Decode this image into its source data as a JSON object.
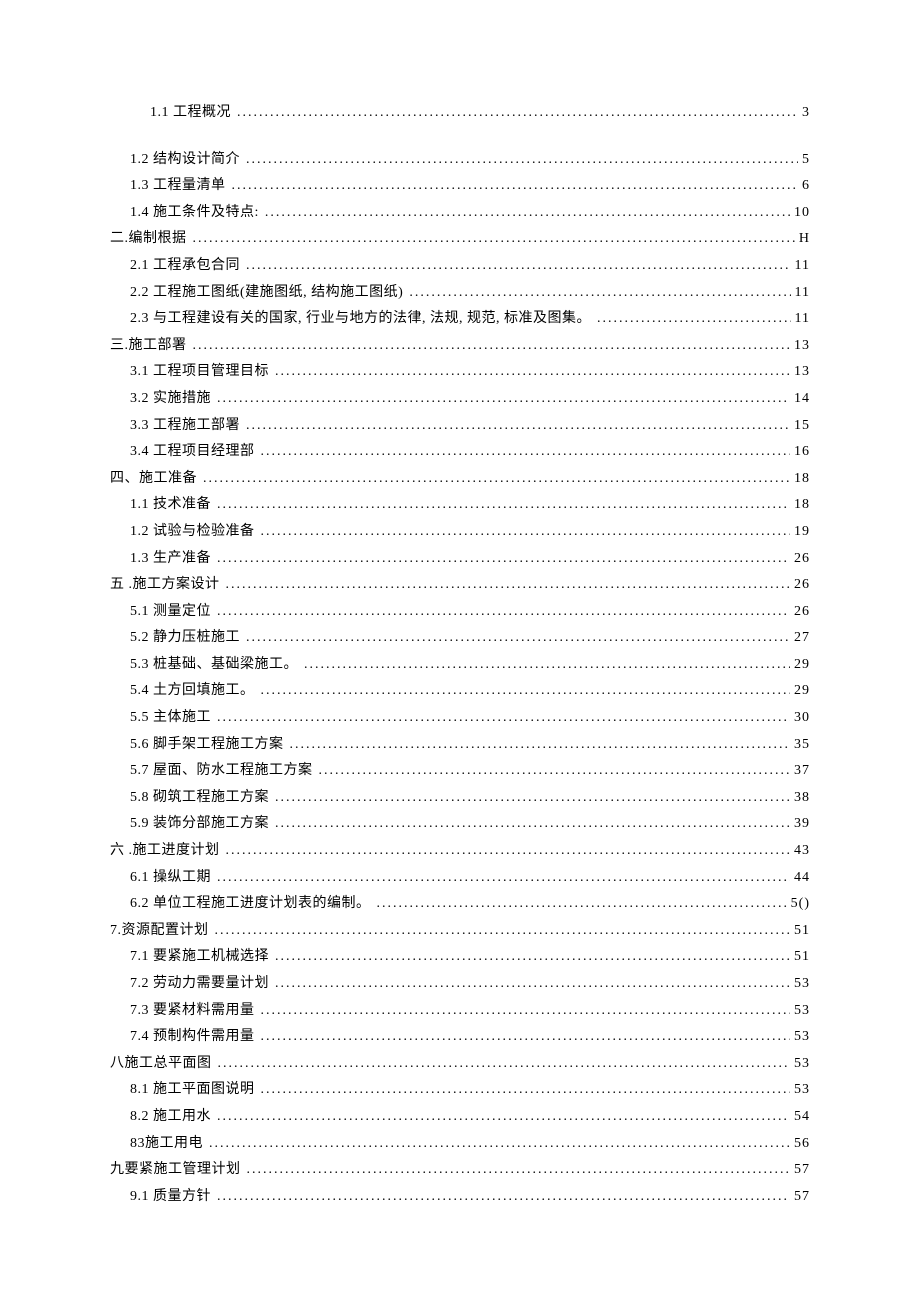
{
  "toc": [
    {
      "indent": "indent-first",
      "label": "1.1 工程概况",
      "page": "3"
    },
    {
      "indent": "indent-1",
      "label": "1.2 结构设计简介",
      "page": "5"
    },
    {
      "indent": "indent-1",
      "label": "1.3 工程量清单",
      "page": "6"
    },
    {
      "indent": "indent-1",
      "label": "1.4 施工条件及特点:",
      "page": "10"
    },
    {
      "indent": "indent-0",
      "label": "二.编制根据",
      "page": "H"
    },
    {
      "indent": "indent-1",
      "label": "2.1 工程承包合同",
      "page": "11"
    },
    {
      "indent": "indent-1",
      "label": "2.2 工程施工图纸(建施图纸, 结构施工图纸)",
      "page": "11"
    },
    {
      "indent": "indent-1",
      "label": "2.3 与工程建设有关的国家, 行业与地方的法律, 法规, 规范, 标准及图集。",
      "page": "11"
    },
    {
      "indent": "indent-0",
      "label": "三.施工部署",
      "page": "13"
    },
    {
      "indent": "indent-1",
      "label": "3.1 工程项目管理目标",
      "page": "13"
    },
    {
      "indent": "indent-1",
      "label": "3.2 实施措施",
      "page": "14"
    },
    {
      "indent": "indent-1",
      "label": "3.3 工程施工部署",
      "page": "15"
    },
    {
      "indent": "indent-1",
      "label": "3.4 工程项目经理部",
      "page": "16"
    },
    {
      "indent": "indent-0",
      "label": "四、施工准备",
      "page": "18"
    },
    {
      "indent": "indent-1",
      "label": "1.1 技术准备",
      "page": "18"
    },
    {
      "indent": "indent-1",
      "label": "1.2 试验与检验准备",
      "page": "19"
    },
    {
      "indent": "indent-1",
      "label": "1.3 生产准备",
      "page": "26"
    },
    {
      "indent": "indent-0",
      "label": "五 .施工方案设计",
      "page": "26"
    },
    {
      "indent": "indent-1",
      "label": "5.1 测量定位",
      "page": "26"
    },
    {
      "indent": "indent-1",
      "label": "5.2 静力压桩施工",
      "page": "27"
    },
    {
      "indent": "indent-1",
      "label": "5.3 桩基础、基础梁施工。",
      "page": "29"
    },
    {
      "indent": "indent-1",
      "label": "5.4 土方回填施工。",
      "page": "29"
    },
    {
      "indent": "indent-1",
      "label": "5.5 主体施工",
      "page": "30"
    },
    {
      "indent": "indent-1",
      "label": "5.6 脚手架工程施工方案",
      "page": "35"
    },
    {
      "indent": "indent-1",
      "label": "5.7 屋面、防水工程施工方案",
      "page": "37"
    },
    {
      "indent": "indent-1",
      "label": "5.8 砌筑工程施工方案",
      "page": "38"
    },
    {
      "indent": "indent-1",
      "label": "5.9 装饰分部施工方案",
      "page": "39"
    },
    {
      "indent": "indent-0",
      "label": "六 .施工进度计划",
      "page": "43"
    },
    {
      "indent": "indent-1",
      "label": "6.1 操纵工期",
      "page": "44"
    },
    {
      "indent": "indent-1",
      "label": "6.2 单位工程施工进度计划表的编制。",
      "page": "5()"
    },
    {
      "indent": "indent-0",
      "label": "7.资源配置计划",
      "page": "51"
    },
    {
      "indent": "indent-1",
      "label": "7.1 要紧施工机械选择",
      "page": "51"
    },
    {
      "indent": "indent-1",
      "label": "7.2 劳动力需要量计划",
      "page": "53"
    },
    {
      "indent": "indent-1",
      "label": "7.3 要紧材料需用量",
      "page": "53"
    },
    {
      "indent": "indent-1",
      "label": "7.4 预制构件需用量",
      "page": "53"
    },
    {
      "indent": "indent-0",
      "label": "八施工总平面图",
      "page": "53"
    },
    {
      "indent": "indent-1",
      "label": "8.1 施工平面图说明",
      "page": "53"
    },
    {
      "indent": "indent-1",
      "label": "8.2 施工用水",
      "page": "54"
    },
    {
      "indent": "indent-1",
      "label": "83施工用电",
      "page": "56"
    },
    {
      "indent": "indent-0",
      "label": "九要紧施工管理计划",
      "page": "57"
    },
    {
      "indent": "indent-1",
      "label": "9.1 质量方针",
      "page": "57"
    }
  ]
}
